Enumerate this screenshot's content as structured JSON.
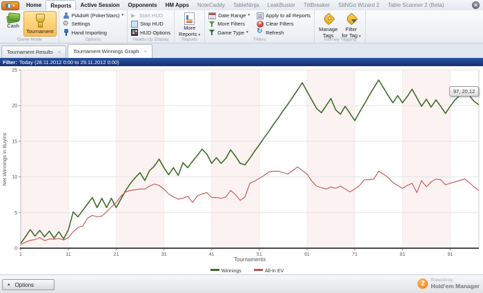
{
  "window": {
    "close_glyph": "×",
    "app_menu_caret": "▾"
  },
  "ribbon_tabs": [
    {
      "label": "Home",
      "style": "main",
      "active": false
    },
    {
      "label": "Reports",
      "style": "main",
      "active": true
    },
    {
      "label": "Active Session",
      "style": "main",
      "active": false
    },
    {
      "label": "Opponents",
      "style": "main",
      "active": false
    },
    {
      "label": "HM Apps",
      "style": "main",
      "active": false
    },
    {
      "label": "NoteCaddy",
      "style": "plugin",
      "active": false
    },
    {
      "label": "TableNinja",
      "style": "plugin",
      "active": false
    },
    {
      "label": "LeakBuster",
      "style": "plugin",
      "active": false
    },
    {
      "label": "TiltBreaker",
      "style": "plugin",
      "active": false
    },
    {
      "label": "SitNGo Wizard 2",
      "style": "plugin",
      "active": false
    },
    {
      "label": "Table Scanner 2 (Beta)",
      "style": "plugin",
      "active": false
    }
  ],
  "ribbon": {
    "groups": [
      {
        "name": "Game Mode",
        "layout": "big",
        "buttons": [
          {
            "label": "Cash",
            "icon": "cash-icon",
            "selected": false
          },
          {
            "label": "Tournament",
            "icon": "trophy-icon",
            "selected": true
          }
        ]
      },
      {
        "name": "Options",
        "layout": "rows",
        "buttons": [
          {
            "label": "PiAdoR (PokerStars)",
            "icon": "user-icon",
            "dropdown": true
          },
          {
            "label": "Settings",
            "icon": "gear-icon"
          },
          {
            "label": "Hand Importing",
            "icon": "import-icon"
          }
        ]
      },
      {
        "name": "Heads-Up Display",
        "layout": "rows",
        "buttons": [
          {
            "label": "Start HUD",
            "icon": "play-icon",
            "disabled": true
          },
          {
            "label": "Stop HUD",
            "icon": "stop-icon"
          },
          {
            "label": "HUD Options",
            "icon": "hud-options-icon"
          }
        ]
      },
      {
        "name": "Reports",
        "layout": "big",
        "buttons": [
          {
            "label": "More",
            "label2": "Reports",
            "icon": "report-icon",
            "dropdown": true
          }
        ]
      },
      {
        "name": "Filters",
        "layout": "rows2col",
        "columns": [
          [
            {
              "label": "Date Range",
              "icon": "date-range-icon",
              "dropdown": true
            },
            {
              "label": "More Filters",
              "icon": "more-filters-icon"
            },
            {
              "label": "Game Type",
              "icon": "game-type-icon",
              "dropdown": true
            }
          ],
          [
            {
              "label": "Apply to all Reports",
              "icon": "apply-icon"
            },
            {
              "label": "Clear Filters",
              "icon": "clear-filters-icon"
            },
            {
              "label": "Refresh",
              "icon": "refresh-icon"
            }
          ]
        ]
      },
      {
        "name": "Tourney Tagging",
        "layout": "big",
        "buttons": [
          {
            "label": "Manage",
            "label2": "Tags",
            "icon": "tag-icon"
          },
          {
            "label": "Filter",
            "label2": "for Tag",
            "icon": "tag-filter-icon",
            "dropdown": true
          }
        ]
      }
    ]
  },
  "doc_tabs": [
    {
      "label": "Tournament Results",
      "close_glyph": "×",
      "active": false
    },
    {
      "label": "Tournament Winnings Graph",
      "close_glyph": "×",
      "active": true
    }
  ],
  "filter_bar": {
    "label": "Filter:",
    "value": "Today (28.11.2012 0:00 to 29.11.2012 0:00)"
  },
  "tooltip": {
    "text": "97, 20,12"
  },
  "chart_data": {
    "type": "line",
    "xlabel": "Tournaments",
    "ylabel": "Net Winnings in Buyins",
    "xlim": [
      1,
      97
    ],
    "ylim": [
      0,
      25
    ],
    "xticks": [
      1,
      11,
      21,
      31,
      41,
      51,
      61,
      71,
      81,
      91
    ],
    "yticks": [
      0,
      5,
      10,
      15,
      20,
      25
    ],
    "grid": true,
    "band_colors": [
      "#fcf2f1",
      "#ffffff"
    ],
    "legend_position": "bottom-center",
    "series": [
      {
        "name": "Winnings",
        "color": "#3e6b28",
        "values": [
          0.7,
          1.6,
          2.6,
          1.7,
          2.5,
          1.6,
          2.4,
          1.4,
          2.3,
          1.3,
          2.6,
          5.1,
          4.4,
          5.3,
          6.2,
          7.1,
          5.7,
          7.0,
          5.7,
          7.0,
          5.7,
          6.9,
          8.1,
          9.1,
          9.9,
          10.6,
          9.5,
          10.9,
          11.5,
          12.5,
          11.3,
          10.3,
          11.3,
          10.2,
          12.0,
          11.3,
          12.2,
          13.0,
          13.9,
          13.2,
          11.9,
          12.7,
          11.9,
          12.6,
          13.8,
          12.9,
          11.9,
          11.7,
          12.6,
          13.6,
          14.5,
          15.5,
          16.4,
          17.4,
          18.3,
          19.3,
          20.2,
          21.2,
          22.2,
          23.2,
          22.0,
          20.8,
          19.6,
          19.0,
          20.0,
          21.0,
          19.4,
          18.8,
          19.9,
          18.9,
          17.9,
          19.1,
          20.2,
          21.4,
          22.5,
          23.6,
          22.5,
          21.4,
          20.4,
          21.4,
          20.4,
          21.3,
          22.3,
          21.1,
          19.9,
          20.9,
          19.8,
          20.8,
          19.9,
          18.9,
          19.9,
          20.8,
          21.4,
          22.1,
          21.4,
          20.6,
          20.12
        ]
      },
      {
        "name": "All-In EV",
        "color": "#c2524e",
        "values": [
          0.5,
          0.85,
          1.1,
          1.2,
          1.5,
          1.05,
          1.3,
          1.25,
          1.35,
          1.15,
          1.5,
          2.3,
          2.9,
          3.1,
          4.2,
          4.6,
          4.4,
          4.5,
          5.1,
          5.8,
          6.4,
          7.3,
          7.9,
          8.1,
          8.2,
          8.3,
          8.3,
          8.7,
          9.0,
          8.8,
          8.3,
          7.6,
          7.2,
          6.9,
          7.0,
          7.3,
          6.4,
          7.3,
          7.6,
          7.8,
          7.1,
          7.1,
          7.0,
          7.2,
          8.1,
          7.5,
          6.7,
          7.2,
          9.1,
          9.4,
          9.8,
          10.2,
          10.7,
          10.8,
          10.8,
          10.6,
          10.4,
          10.9,
          11.4,
          10.9,
          10.4,
          9.4,
          8.7,
          8.5,
          8.3,
          8.6,
          8.4,
          8.7,
          8.3,
          7.9,
          8.3,
          8.8,
          9.6,
          9.6,
          9.7,
          10.8,
          10.4,
          9.9,
          9.2,
          8.8,
          8.4,
          8.8,
          9.1,
          7.8,
          9.5,
          8.6,
          9.3,
          9.7,
          9.6,
          8.9,
          9.1,
          9.3,
          9.5,
          9.7,
          9.2,
          8.6,
          8.1
        ]
      }
    ],
    "last_point_label": "97, 20,12"
  },
  "status_bar": {
    "options_label": "Options",
    "powered_by_small": "Powered by",
    "powered_by_brand": "Hold'em Manager",
    "badge": "2"
  }
}
